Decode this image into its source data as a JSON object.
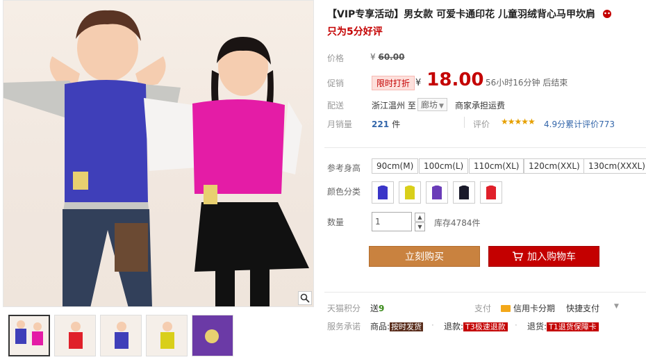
{
  "product": {
    "title": "【VIP专享活动】男女款 可爱卡通印花 儿童羽绒背心马甲坎肩",
    "subtitle": "只为5分好评"
  },
  "price": {
    "label": "价格",
    "currency": "¥",
    "original": "60.00",
    "promo_label": "促销",
    "promo_tag": "限时打折",
    "promo_price": "18.00",
    "countdown": "56小时16分钟 后结束"
  },
  "shipping": {
    "label": "配送",
    "from": "浙江温州",
    "to_word": "至",
    "to": "廊坊",
    "fee": "商家承担运费"
  },
  "sales": {
    "label": "月销量",
    "count": "221",
    "unit": "件",
    "rating_label": "评价",
    "stars": "★★★★★",
    "score": "4.9分",
    "reviews": "累计评价773"
  },
  "sizes": {
    "label": "参考身高",
    "options": [
      "90cm(M)",
      "100cm(L)",
      "110cm(XL)",
      "120cm(XXL)",
      "130cm(XXXL)"
    ]
  },
  "colors": {
    "label": "颜色分类",
    "options": [
      "#3a35c8",
      "#d9cf1a",
      "#6a3cb8",
      "#1a1a2a",
      "#e0202a"
    ]
  },
  "quantity": {
    "label": "数量",
    "value": "1",
    "stock": "库存4784件"
  },
  "actions": {
    "buy": "立刻购买",
    "cart": "加入购物车"
  },
  "extras": {
    "points_label": "天猫积分",
    "points_prefix": "送",
    "points_value": "9",
    "pay_label": "支付",
    "pay_card": "信用卡分期",
    "pay_fast": "快捷支付",
    "service_label": "服务承诺",
    "service_goods": "商品:",
    "service_goods_tag": "按时发货",
    "service_refund": "退款:",
    "service_refund_tag": "T3极速退款",
    "service_return": "退货:",
    "service_return_tag": "T1退货保障卡"
  },
  "colors_theme": {
    "accent": "#c40000",
    "buy_button": "#c9823f"
  }
}
